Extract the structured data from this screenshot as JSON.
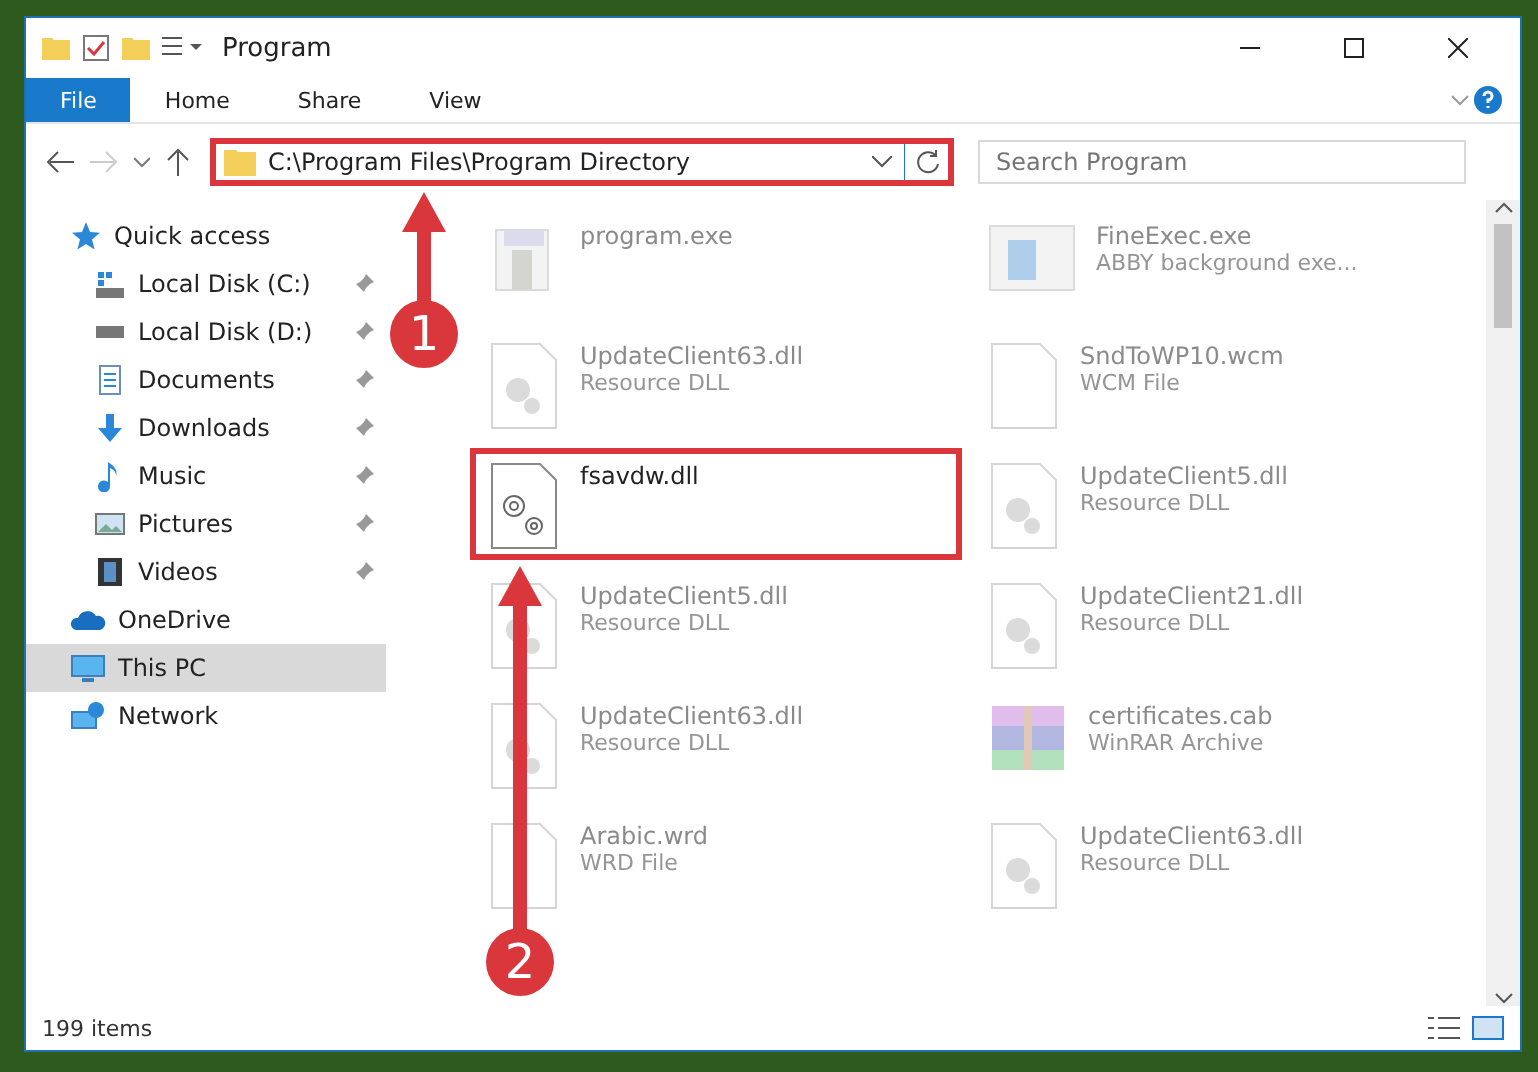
{
  "window": {
    "title": "Program"
  },
  "ribbon": {
    "tabs": [
      {
        "label": "File",
        "selected": true
      },
      {
        "label": "Home",
        "selected": false
      },
      {
        "label": "Share",
        "selected": false
      },
      {
        "label": "View",
        "selected": false
      }
    ]
  },
  "address_bar": {
    "path": "C:\\Program Files\\Program Directory",
    "highlighted": true
  },
  "search": {
    "placeholder": "Search Program"
  },
  "sidebar": {
    "items": [
      {
        "label": "Quick access",
        "selected": false,
        "children": [
          {
            "label": "Local Disk (C:)",
            "pinned": true,
            "selected": false
          },
          {
            "label": "Local Disk (D:)",
            "pinned": true,
            "selected": false
          },
          {
            "label": "Documents",
            "pinned": true,
            "selected": false
          },
          {
            "label": "Downloads",
            "pinned": true,
            "selected": false
          },
          {
            "label": "Music",
            "pinned": true,
            "selected": false
          },
          {
            "label": "Pictures",
            "pinned": true,
            "selected": false
          },
          {
            "label": "Videos",
            "pinned": true,
            "selected": false
          }
        ]
      },
      {
        "label": "OneDrive",
        "selected": false
      },
      {
        "label": "This PC",
        "selected": true
      },
      {
        "label": "Network",
        "selected": false
      }
    ]
  },
  "files": [
    {
      "name": "program.exe",
      "kind": "exe",
      "dimmed": true,
      "highlighted": false
    },
    {
      "name": "FineExec.exe",
      "type": "ABBY background exe...",
      "kind": "app",
      "dimmed": true,
      "highlighted": false
    },
    {
      "name": "UpdateClient63.dll",
      "type": "Resource DLL",
      "kind": "dll",
      "dimmed": true,
      "highlighted": false
    },
    {
      "name": "SndToWP10.wcm",
      "type": "WCM File",
      "kind": "blank",
      "dimmed": true,
      "highlighted": false
    },
    {
      "name": "fsavdw.dll",
      "kind": "gears",
      "dimmed": false,
      "highlighted": true
    },
    {
      "name": "UpdateClient5.dll",
      "type": "Resource DLL",
      "kind": "dll",
      "dimmed": true,
      "highlighted": false
    },
    {
      "name": "UpdateClient5.dll",
      "type": "Resource DLL",
      "kind": "dll",
      "dimmed": true,
      "highlighted": false
    },
    {
      "name": "UpdateClient21.dll",
      "type": "Resource DLL",
      "kind": "dll",
      "dimmed": true,
      "highlighted": false
    },
    {
      "name": "UpdateClient63.dll",
      "type": "Resource DLL",
      "kind": "dll",
      "dimmed": true,
      "highlighted": false
    },
    {
      "name": "certificates.cab",
      "type": "WinRAR Archive",
      "kind": "archive",
      "dimmed": true,
      "highlighted": false
    },
    {
      "name": "Arabic.wrd",
      "type": "WRD File",
      "kind": "blank",
      "dimmed": true,
      "highlighted": false
    },
    {
      "name": "UpdateClient63.dll",
      "type": "Resource DLL",
      "kind": "dll",
      "dimmed": true,
      "highlighted": false
    }
  ],
  "status_bar": {
    "count": "199 items"
  },
  "annotations": [
    {
      "label": "1"
    },
    {
      "label": "2"
    }
  ]
}
